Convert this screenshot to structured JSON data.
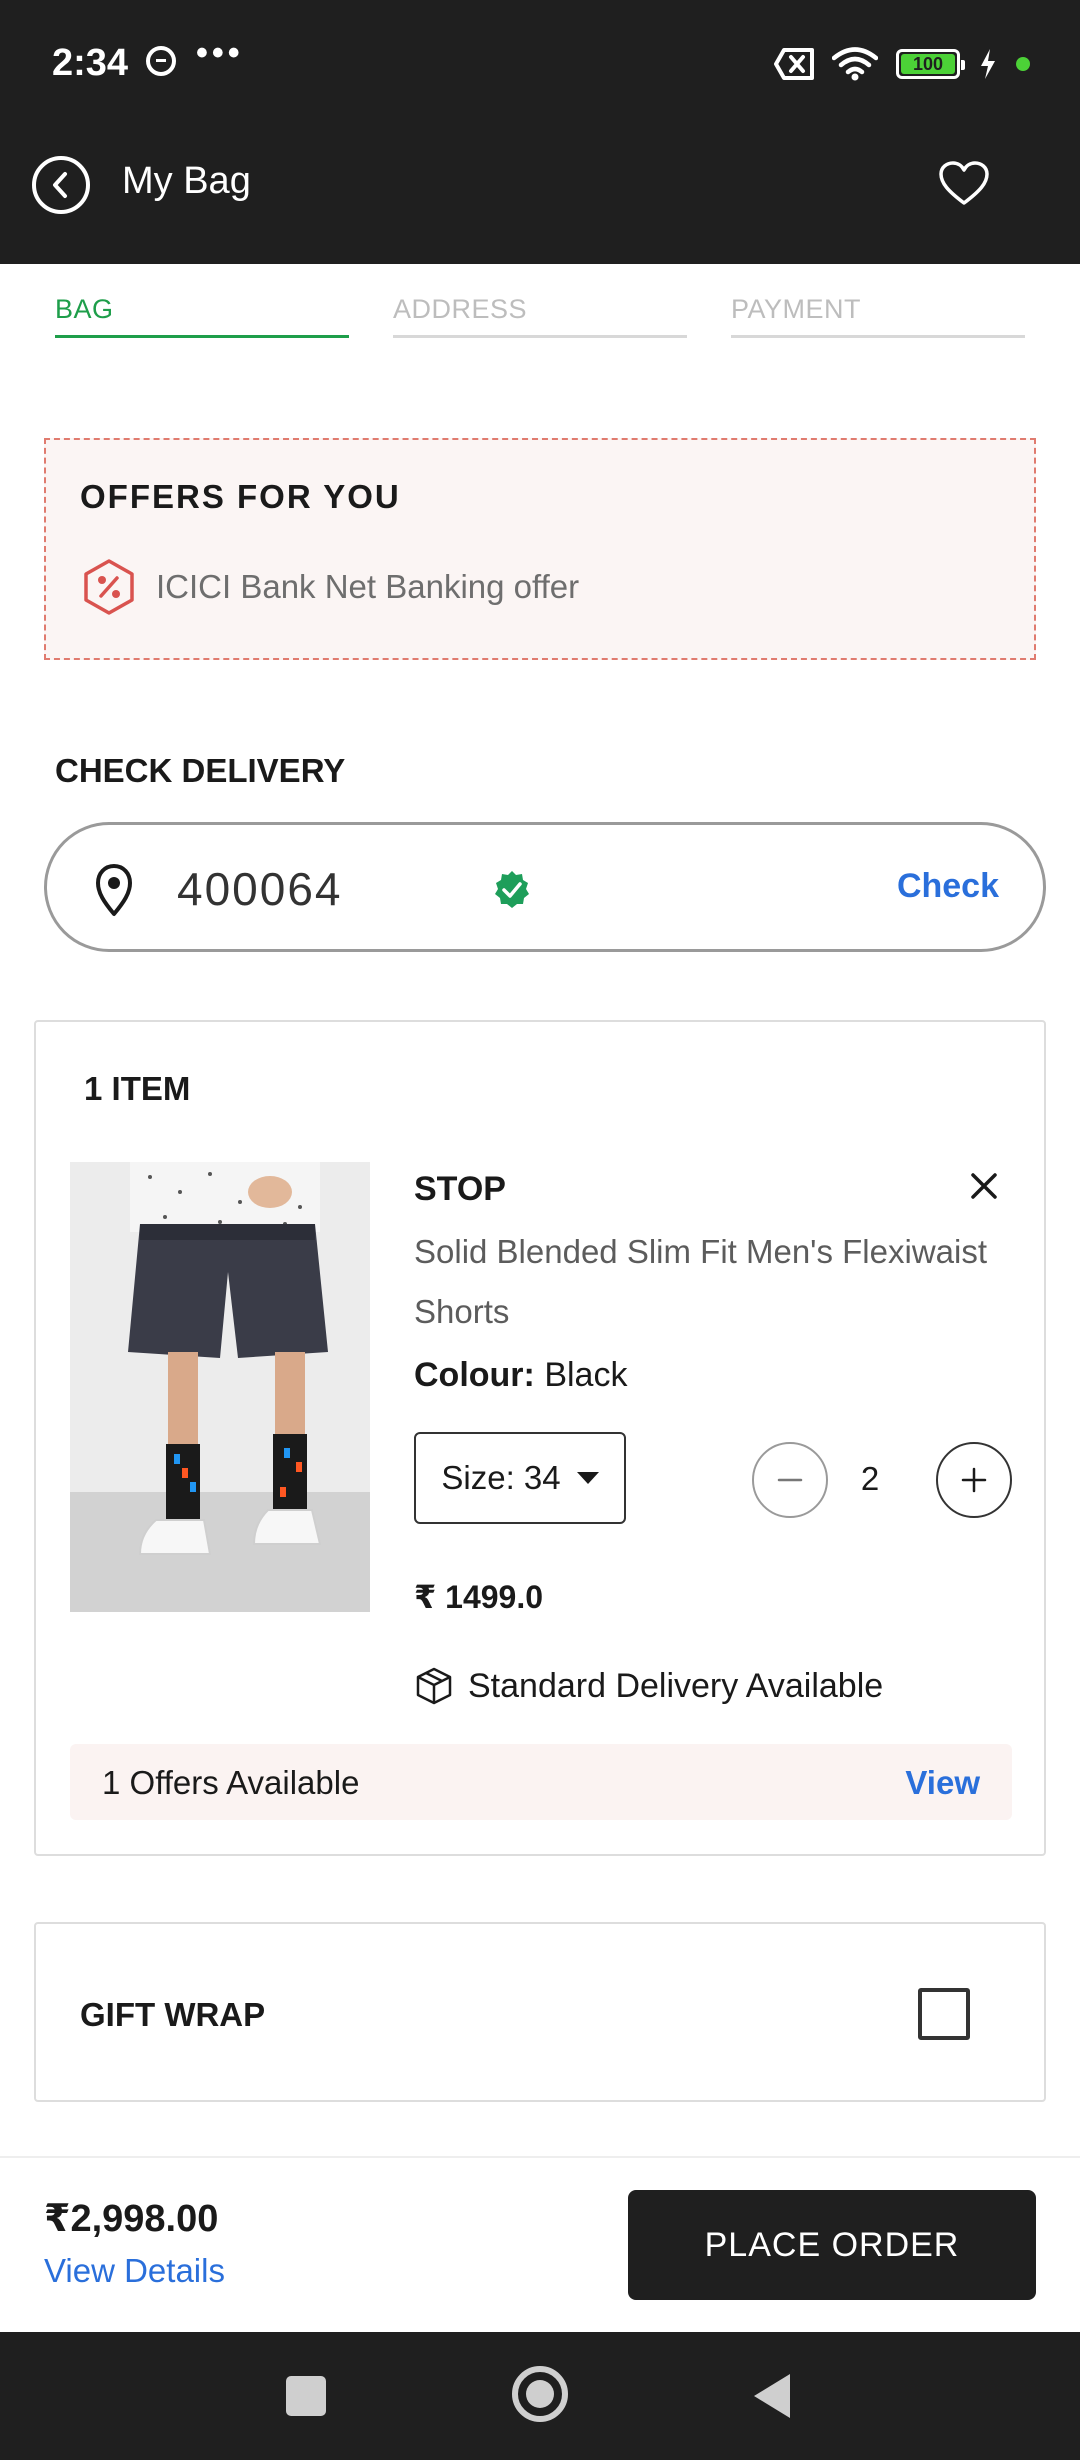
{
  "status_bar": {
    "time": "2:34",
    "more": "•••",
    "battery": "100",
    "icons": [
      "cat-icon",
      "more-dots-icon",
      "sim-x-icon",
      "wifi-icon",
      "battery-icon",
      "charging-icon"
    ]
  },
  "header": {
    "title": "My Bag",
    "back_icon": "chevron-left-icon",
    "wishlist_icon": "heart-icon"
  },
  "steps": [
    {
      "label": "BAG",
      "active": true
    },
    {
      "label": "ADDRESS",
      "active": false
    },
    {
      "label": "PAYMENT",
      "active": false
    }
  ],
  "offers": {
    "title": "OFFERS FOR YOU",
    "items": [
      {
        "label": "ICICI Bank Net Banking offer",
        "icon": "discount-badge-icon"
      }
    ]
  },
  "check_delivery": {
    "title": "CHECK DELIVERY",
    "pincode": "400064",
    "button": "Check",
    "verified": true
  },
  "bag": {
    "item_count": "1 ITEM",
    "items": [
      {
        "brand": "STOP",
        "name": "Solid Blended Slim Fit Men's Flexiwaist Shorts",
        "colour_label": "Colour:",
        "colour": "Black",
        "size": "Size: 34",
        "quantity": "2",
        "price": "₹ 1499.0",
        "delivery": "Standard Delivery Available",
        "offers": "1 Offers Available",
        "offers_link": "View"
      }
    ]
  },
  "gift_wrap": {
    "label": "GIFT WRAP",
    "checked": false
  },
  "footer": {
    "total": "₹2,998.00",
    "view_details": "View Details",
    "place_order": "PLACE ORDER"
  },
  "colors": {
    "header_bg": "#1f1f1f",
    "accent_green": "#1e9e4a",
    "link_blue": "#2a6fdb",
    "offer_border": "#e07b6f",
    "offer_bg": "#fbf5f4"
  }
}
